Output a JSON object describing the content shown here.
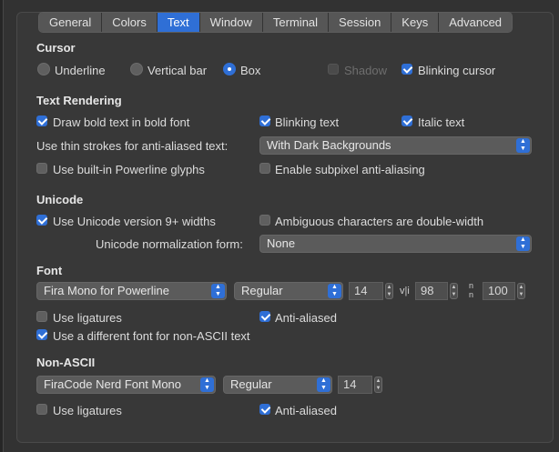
{
  "tabs": [
    "General",
    "Colors",
    "Text",
    "Window",
    "Terminal",
    "Session",
    "Keys",
    "Advanced"
  ],
  "active_tab": "Text",
  "cursor": {
    "heading": "Cursor",
    "underline": "Underline",
    "vertical_bar": "Vertical bar",
    "box": "Box",
    "shadow": "Shadow",
    "blinking_cursor": "Blinking cursor"
  },
  "text_rendering": {
    "heading": "Text Rendering",
    "bold": "Draw bold text in bold font",
    "blinking_text": "Blinking text",
    "italic_text": "Italic text",
    "thin_strokes_label": "Use thin strokes for anti-aliased text:",
    "thin_strokes_value": "With Dark Backgrounds",
    "powerline": "Use built-in Powerline glyphs",
    "subpixel": "Enable subpixel anti-aliasing"
  },
  "unicode": {
    "heading": "Unicode",
    "version9": "Use Unicode version 9+ widths",
    "ambiguous": "Ambiguous characters are double-width",
    "normalization_label": "Unicode normalization form:",
    "normalization_value": "None"
  },
  "font": {
    "heading": "Font",
    "family": "Fira Mono for Powerline",
    "weight": "Regular",
    "size": "14",
    "hspacing": "98",
    "vspacing": "100",
    "ligatures": "Use ligatures",
    "anti_aliased": "Anti-aliased",
    "different_font": "Use a different font for non-ASCII text"
  },
  "non_ascii": {
    "heading": "Non-ASCII",
    "family": "FiraCode Nerd Font Mono",
    "weight": "Regular",
    "size": "14",
    "ligatures": "Use ligatures",
    "anti_aliased": "Anti-aliased"
  },
  "colors": {
    "accent": "#2f6fd6",
    "background": "#383838"
  }
}
